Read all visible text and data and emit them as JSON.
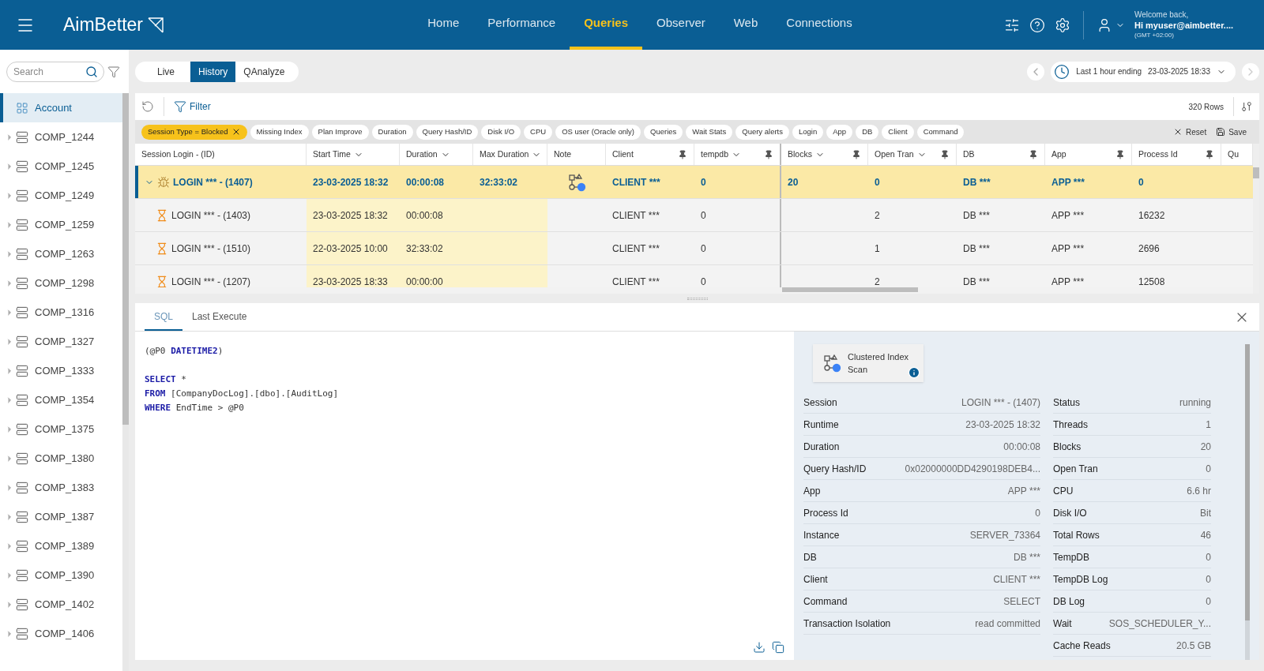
{
  "header": {
    "brand": "AimBetter",
    "nav": [
      {
        "label": "Home",
        "selected": false
      },
      {
        "label": "Performance",
        "selected": false
      },
      {
        "label": "Queries",
        "selected": true
      },
      {
        "label": "Observer",
        "selected": false
      },
      {
        "label": "Web",
        "selected": false
      },
      {
        "label": "Connections",
        "selected": false
      }
    ],
    "user": {
      "greeting": "Welcome back,",
      "name": "Hi myuser@aimbetter....",
      "timezone": "(GMT +02:00)"
    }
  },
  "sidebar": {
    "search": {
      "placeholder": "Search"
    },
    "items": [
      {
        "label": "Account",
        "selected": true,
        "kind": "account"
      },
      {
        "label": "COMP_1244",
        "selected": false,
        "kind": "company"
      },
      {
        "label": "COMP_1245",
        "selected": false,
        "kind": "company"
      },
      {
        "label": "COMP_1249",
        "selected": false,
        "kind": "company"
      },
      {
        "label": "COMP_1259",
        "selected": false,
        "kind": "company"
      },
      {
        "label": "COMP_1263",
        "selected": false,
        "kind": "company"
      },
      {
        "label": "COMP_1298",
        "selected": false,
        "kind": "company"
      },
      {
        "label": "COMP_1316",
        "selected": false,
        "kind": "company"
      },
      {
        "label": "COMP_1327",
        "selected": false,
        "kind": "company"
      },
      {
        "label": "COMP_1333",
        "selected": false,
        "kind": "company"
      },
      {
        "label": "COMP_1354",
        "selected": false,
        "kind": "company"
      },
      {
        "label": "COMP_1375",
        "selected": false,
        "kind": "company"
      },
      {
        "label": "COMP_1380",
        "selected": false,
        "kind": "company"
      },
      {
        "label": "COMP_1383",
        "selected": false,
        "kind": "company"
      },
      {
        "label": "COMP_1387",
        "selected": false,
        "kind": "company"
      },
      {
        "label": "COMP_1389",
        "selected": false,
        "kind": "company"
      },
      {
        "label": "COMP_1390",
        "selected": false,
        "kind": "company"
      },
      {
        "label": "COMP_1402",
        "selected": false,
        "kind": "company"
      },
      {
        "label": "COMP_1406",
        "selected": false,
        "kind": "company"
      }
    ]
  },
  "mode_tabs": [
    {
      "label": "Live",
      "selected": false
    },
    {
      "label": "History",
      "selected": true
    },
    {
      "label": "QAnalyze",
      "selected": false
    }
  ],
  "time_range": {
    "label": "Last 1 hour ending",
    "value": "23-03-2025 18:33"
  },
  "toolbar": {
    "filter": "Filter",
    "row_count": "320 Rows",
    "reset": "Reset",
    "save": "Save"
  },
  "filters": [
    {
      "label": "Session Type = Blocked",
      "selected": true
    },
    {
      "label": "Missing Index",
      "selected": false
    },
    {
      "label": "Plan Improve",
      "selected": false
    },
    {
      "label": "Duration",
      "selected": false
    },
    {
      "label": "Query Hash/ID",
      "selected": false
    },
    {
      "label": "Disk I/O",
      "selected": false
    },
    {
      "label": "CPU",
      "selected": false
    },
    {
      "label": "OS user (Oracle only)",
      "selected": false
    },
    {
      "label": "Queries",
      "selected": false
    },
    {
      "label": "Wait Stats",
      "selected": false
    },
    {
      "label": "Query alerts",
      "selected": false
    },
    {
      "label": "Login",
      "selected": false
    },
    {
      "label": "App",
      "selected": false
    },
    {
      "label": "DB",
      "selected": false
    },
    {
      "label": "Client",
      "selected": false
    },
    {
      "label": "Command",
      "selected": false
    }
  ],
  "table": {
    "columns": [
      {
        "label": "Session Login - (ID)",
        "sortable": false,
        "pinnable": false,
        "highlighted": false
      },
      {
        "label": "Start Time",
        "sortable": true,
        "pinnable": false,
        "highlighted": true
      },
      {
        "label": "Duration",
        "sortable": true,
        "pinnable": false,
        "highlighted": true
      },
      {
        "label": "Max Duration",
        "sortable": true,
        "pinnable": false,
        "highlighted": true
      },
      {
        "label": "Note",
        "sortable": false,
        "pinnable": false,
        "highlighted": false
      },
      {
        "label": "Client",
        "sortable": false,
        "pinnable": true,
        "highlighted": false
      },
      {
        "label": "tempdb",
        "sortable": true,
        "pinnable": true,
        "highlighted": false
      },
      {
        "label": "Blocks",
        "sortable": true,
        "pinnable": true,
        "highlighted": false
      },
      {
        "label": "Open Tran",
        "sortable": true,
        "pinnable": true,
        "highlighted": false
      },
      {
        "label": "DB",
        "sortable": false,
        "pinnable": true,
        "highlighted": false
      },
      {
        "label": "App",
        "sortable": false,
        "pinnable": true,
        "highlighted": false
      },
      {
        "label": "Process Id",
        "sortable": false,
        "pinnable": true,
        "highlighted": false
      },
      {
        "label": "Qu",
        "sortable": false,
        "pinnable": false,
        "highlighted": false
      }
    ],
    "rows": [
      {
        "kind": "blocker",
        "selected": true,
        "expanded": true,
        "has_plan": true,
        "cells": [
          "LOGIN *** - (1407)",
          "23-03-2025 18:32",
          "00:00:08",
          "32:33:02",
          "",
          "CLIENT ***",
          "0",
          "20",
          "0",
          "DB ***",
          "APP ***",
          "0"
        ]
      },
      {
        "kind": "blocked",
        "selected": false,
        "has_plan": false,
        "cells": [
          "LOGIN *** - (1403)",
          "23-03-2025 18:32",
          "00:00:08",
          "",
          "",
          "CLIENT ***",
          "0",
          "",
          "2",
          "DB ***",
          "APP ***",
          "16232"
        ]
      },
      {
        "kind": "blocked",
        "selected": false,
        "has_plan": false,
        "cells": [
          "LOGIN *** - (1510)",
          "22-03-2025 10:00",
          "32:33:02",
          "",
          "",
          "CLIENT ***",
          "0",
          "",
          "1",
          "DB ***",
          "APP ***",
          "2696"
        ]
      },
      {
        "kind": "blocked",
        "selected": false,
        "has_plan": false,
        "cells": [
          "LOGIN *** - (1207)",
          "23-03-2025 18:33",
          "00:00:00",
          "",
          "",
          "CLIENT ***",
          "0",
          "",
          "2",
          "DB ***",
          "APP ***",
          "12508"
        ]
      }
    ]
  },
  "detail_tabs": [
    {
      "label": "SQL",
      "selected": true
    },
    {
      "label": "Last Execute",
      "selected": false
    }
  ],
  "sql": [
    {
      "kind": "code",
      "tokens": [
        {
          "text": "(@P0 ",
          "kind": "plain"
        },
        {
          "text": "DATETIME2",
          "kind": "keyword"
        },
        {
          "text": ")",
          "kind": "plain"
        }
      ]
    },
    {
      "kind": "blank"
    },
    {
      "kind": "code",
      "tokens": [
        {
          "text": "SELECT",
          "kind": "keyword"
        },
        {
          "text": " *",
          "kind": "plain"
        }
      ]
    },
    {
      "kind": "code",
      "tokens": [
        {
          "text": "FROM",
          "kind": "keyword"
        },
        {
          "text": " [CompanyDocLog].[dbo].[AuditLog]",
          "kind": "plain"
        }
      ]
    },
    {
      "kind": "code",
      "tokens": [
        {
          "text": "WHERE",
          "kind": "keyword"
        },
        {
          "text": " EndTime > @P0",
          "kind": "plain"
        }
      ]
    }
  ],
  "plan_operator": "Clustered Index Scan",
  "details_left": [
    {
      "label": "Session",
      "value": "LOGIN *** - (1407)"
    },
    {
      "label": "Runtime",
      "value": "23-03-2025 18:32"
    },
    {
      "label": "Duration",
      "value": "00:00:08"
    },
    {
      "label": "Query Hash/ID",
      "value": "0x02000000DD4290198DEB4..."
    },
    {
      "label": "App",
      "value": "APP ***"
    },
    {
      "label": "Process Id",
      "value": "0"
    },
    {
      "label": "Instance",
      "value": "SERVER_73364"
    },
    {
      "label": "DB",
      "value": "DB ***"
    },
    {
      "label": "Client",
      "value": "CLIENT ***"
    },
    {
      "label": "Command",
      "value": "SELECT"
    },
    {
      "label": "Transaction Isolation",
      "value": "read committed"
    }
  ],
  "details_right": [
    {
      "label": "Status",
      "value": "running"
    },
    {
      "label": "Threads",
      "value": "1"
    },
    {
      "label": "Blocks",
      "value": "20"
    },
    {
      "label": "Open Tran",
      "value": "0"
    },
    {
      "label": "CPU",
      "value": "6.6 hr"
    },
    {
      "label": "Disk I/O",
      "value": "Bit"
    },
    {
      "label": "Total Rows",
      "value": "46"
    },
    {
      "label": "TempDB",
      "value": "0"
    },
    {
      "label": "TempDB Log",
      "value": "0"
    },
    {
      "label": "DB Log",
      "value": "0"
    },
    {
      "label": "Wait",
      "value": "SOS_SCHEDULER_Y..."
    },
    {
      "label": "Cache Reads",
      "value": "20.5 GB"
    }
  ]
}
